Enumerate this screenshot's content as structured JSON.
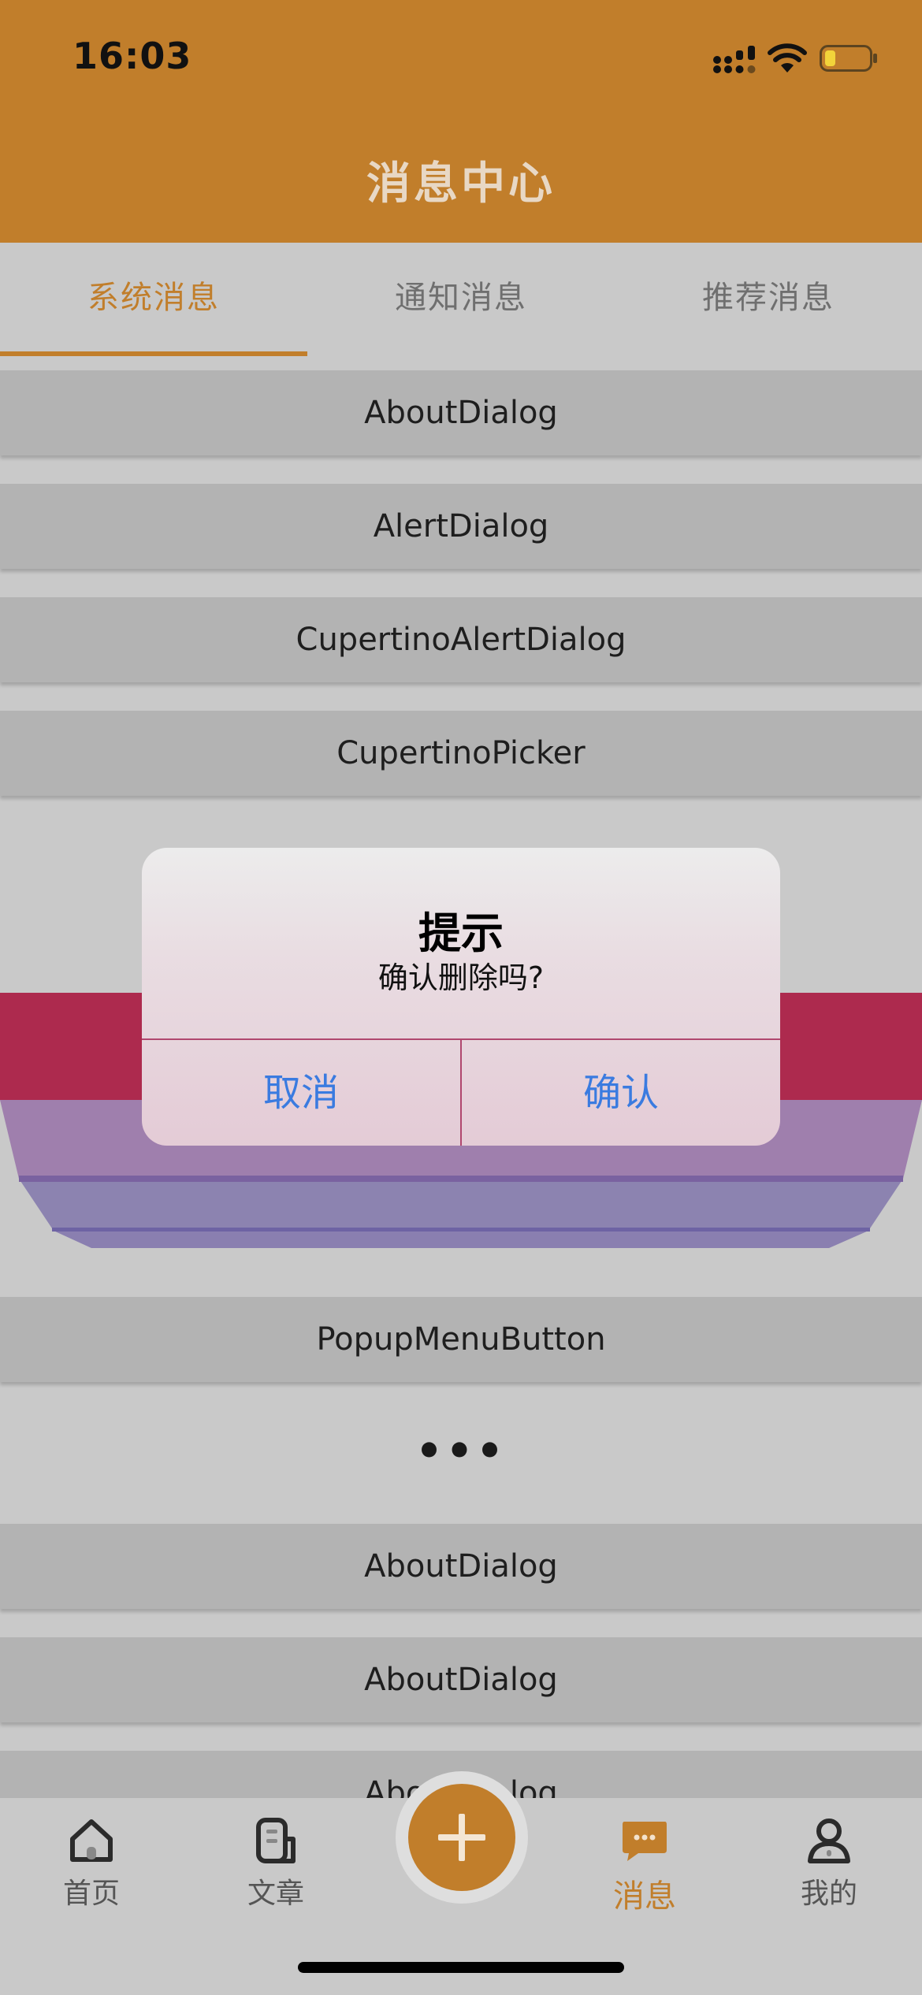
{
  "status_bar": {
    "time": "16:03"
  },
  "header": {
    "title": "消息中心"
  },
  "tabs": [
    {
      "label": "系统消息",
      "active": true
    },
    {
      "label": "通知消息",
      "active": false
    },
    {
      "label": "推荐消息",
      "active": false
    }
  ],
  "list": {
    "items": [
      "AboutDialog",
      "AlertDialog",
      "CupertinoAlertDialog",
      "CupertinoPicker",
      "PopupMenuButton",
      "AboutDialog",
      "AboutDialog",
      "AboutDialog"
    ],
    "ellipsis": "•••"
  },
  "dialog": {
    "title": "提示",
    "message": "确认删除吗?",
    "cancel_label": "取消",
    "confirm_label": "确认"
  },
  "bottom_nav": {
    "items": [
      {
        "label": "首页",
        "icon": "home-icon",
        "active": false
      },
      {
        "label": "文章",
        "icon": "article-icon",
        "active": false
      },
      {
        "label": "消息",
        "icon": "message-icon",
        "active": true
      },
      {
        "label": "我的",
        "icon": "profile-icon",
        "active": false
      }
    ],
    "fab_icon": "plus-icon"
  },
  "colors": {
    "accent": "#c17e2b",
    "dialog_button_text": "#3a7be0",
    "picker_highlight": "#ad2a4e",
    "picker_body": "#9f7fad"
  }
}
